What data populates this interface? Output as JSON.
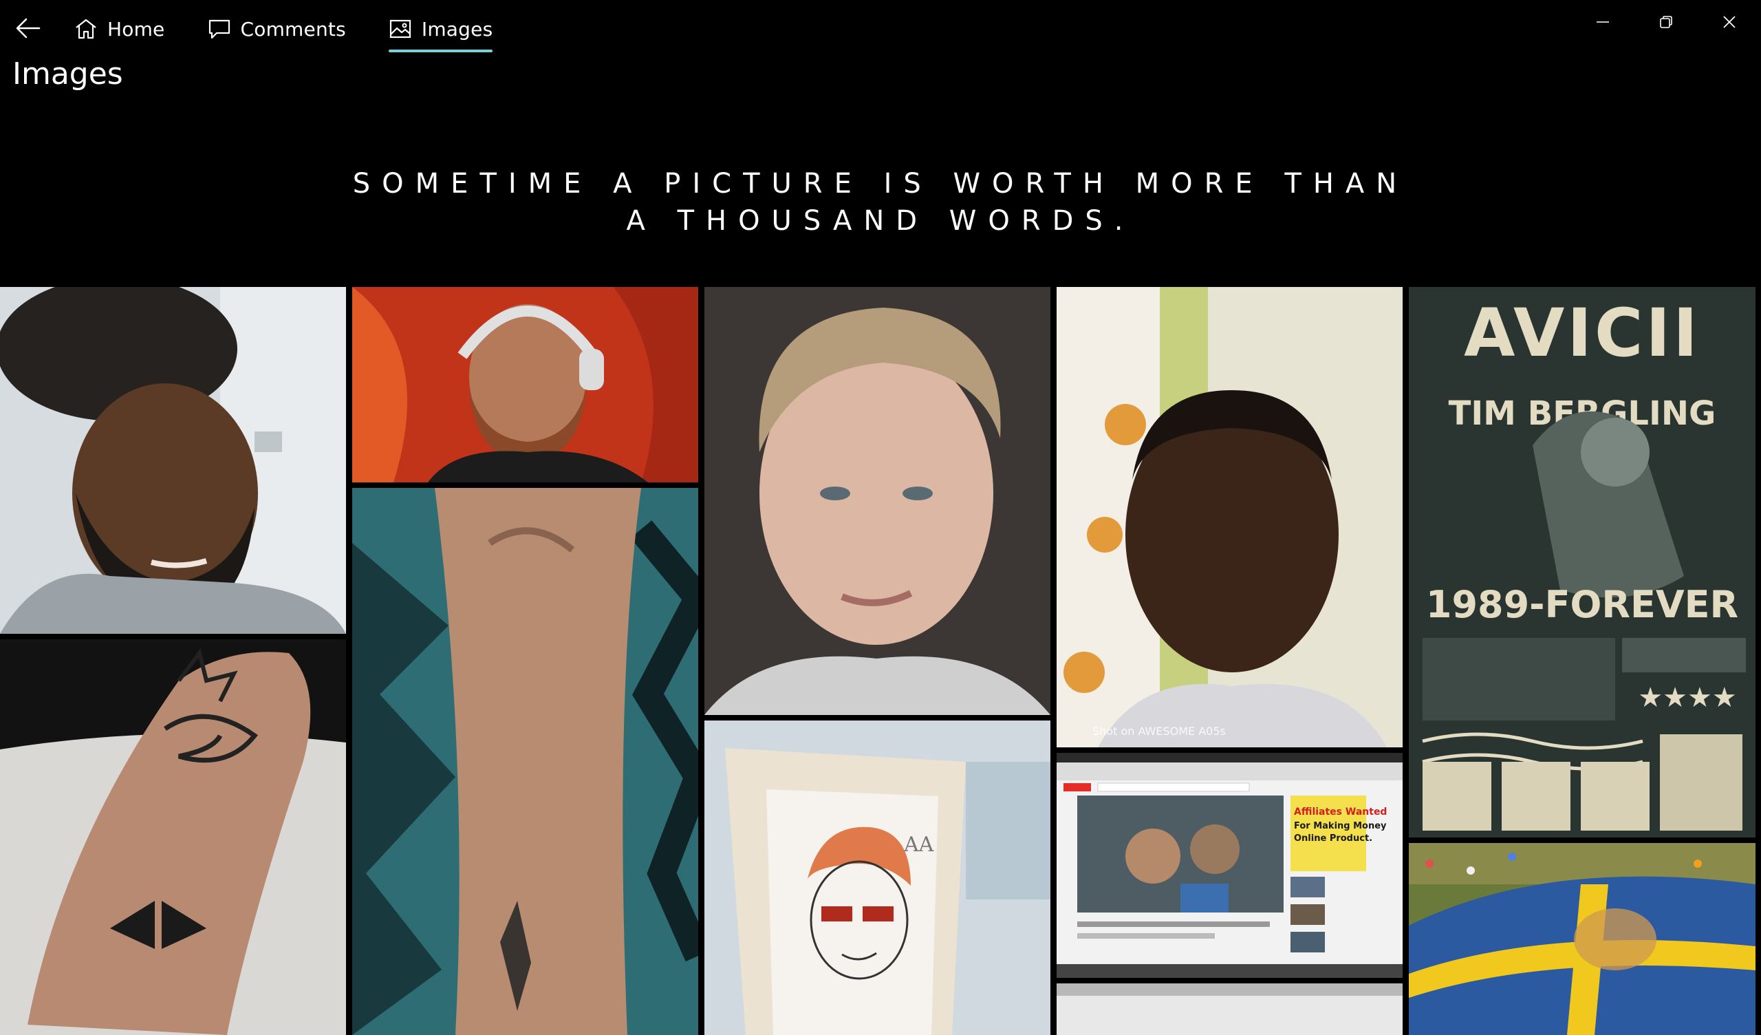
{
  "nav": {
    "back": "back",
    "items": [
      {
        "label": "Home",
        "icon": "home-icon"
      },
      {
        "label": "Comments",
        "icon": "comment-icon"
      },
      {
        "label": "Images",
        "icon": "image-icon",
        "active": true
      }
    ]
  },
  "window_controls": [
    "minimize",
    "restore",
    "close"
  ],
  "page": {
    "title": "Images",
    "tagline_line1": "SOMETIME A PICTURE IS WORTH MORE THAN",
    "tagline_line2": "A THOUSAND WORDS."
  },
  "gallery": {
    "tiles": [
      {
        "subject": "man with high-top hair and beard"
      },
      {
        "subject": "DJ with headphones"
      },
      {
        "subject": "smiling blond boy"
      },
      {
        "subject": "boy selfie",
        "caption": "Shot on AWESOME A05s"
      },
      {
        "subject": "Avicii poster",
        "text_main": "AVICII",
        "text_name": "TIM BERGLING",
        "text_years": "1989-FOREVER",
        "text_stars": "★★★★"
      },
      {
        "subject": "forearm triangle tattoo"
      },
      {
        "subject": "arm with triangle tattoo"
      },
      {
        "subject": "drawing of boy with sunglasses",
        "text_initials": "AA"
      },
      {
        "subject": "browser screenshot",
        "ad_line1": "Affiliates Wanted",
        "ad_line2": "For Making Money",
        "ad_line3": "Online Product."
      },
      {
        "subject": "crowd with Swedish flag"
      },
      {
        "subject": "partial white image"
      }
    ]
  },
  "colors": {
    "background": "#000000",
    "accent_underline": "#7ad1d9",
    "text": "#ffffff"
  }
}
